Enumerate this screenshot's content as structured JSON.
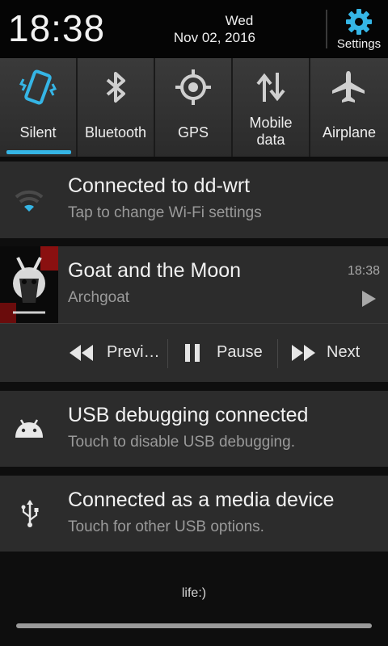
{
  "header": {
    "time": "18:38",
    "day": "Wed",
    "date": "Nov 02, 2016",
    "settings_label": "Settings",
    "settings_icon": "gear-icon",
    "accent_color": "#35b5e5"
  },
  "toggles": [
    {
      "label": "Silent",
      "icon": "vibrate-phone-icon",
      "active": true
    },
    {
      "label": "Bluetooth",
      "icon": "bluetooth-icon",
      "active": false
    },
    {
      "label": "GPS",
      "icon": "gps-icon",
      "active": false
    },
    {
      "label_line1": "Mobile",
      "label_line2": "data",
      "icon": "mobile-data-icon",
      "active": false
    },
    {
      "label": "Airplane",
      "icon": "airplane-icon",
      "active": false
    }
  ],
  "wifi": {
    "title": "Connected to dd-wrt",
    "subtitle": "Tap to change Wi-Fi settings",
    "icon": "wifi-icon"
  },
  "media": {
    "title": "Goat and the Moon",
    "artist": "Archgoat",
    "time": "18:38",
    "prev_label": "Previ…",
    "pause_label": "Pause",
    "next_label": "Next"
  },
  "usb_debug": {
    "title": "USB debugging connected",
    "subtitle": "Touch to disable USB debugging.",
    "icon": "android-icon"
  },
  "usb_media": {
    "title": "Connected as a media device",
    "subtitle": "Touch for other USB options.",
    "icon": "usb-icon"
  },
  "footer": {
    "text": "life:)"
  }
}
